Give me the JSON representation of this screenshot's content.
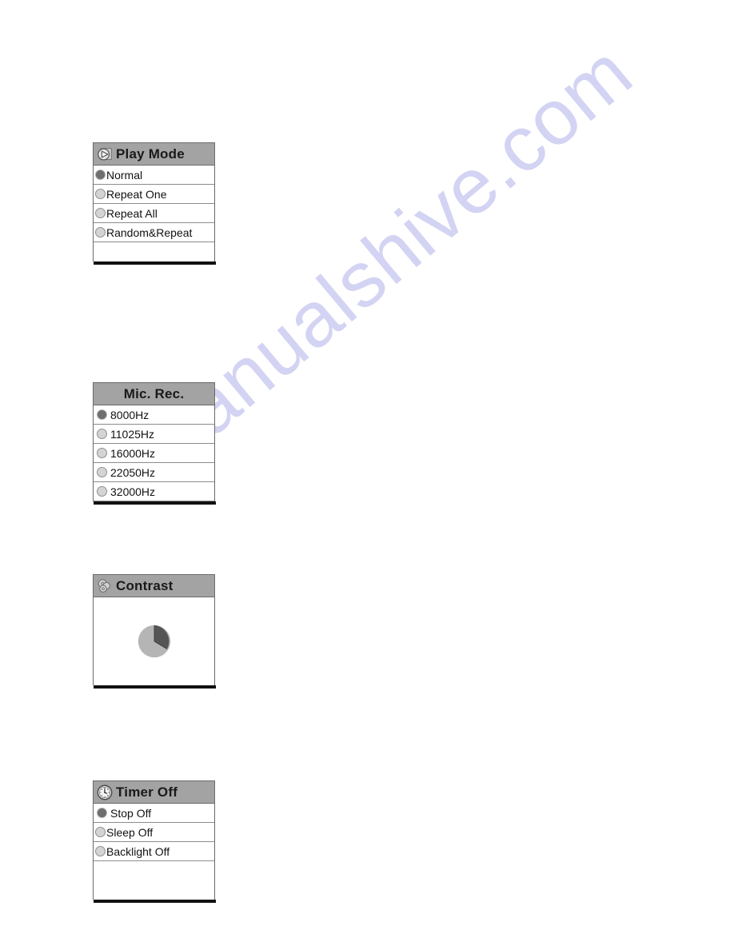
{
  "document": {
    "watermark": "manualshive.com",
    "background_color": "#ffffff"
  },
  "theme": {
    "header_gray": "#a3a3a3",
    "border_gray": "#6b6b6b",
    "row_divider": "#8c8c8c",
    "radio_selected": "#6e6e6e",
    "radio_unselected": "#d4d4d4",
    "baseline_black": "#111111",
    "text": "#111111",
    "watermark_color": "#ccccf2"
  },
  "screens": [
    {
      "id": "play-mode",
      "title": "Play Mode",
      "icon": "play-icon",
      "title_align": "left",
      "options": [
        {
          "label": "Normal",
          "selected": true
        },
        {
          "label": "Repeat One",
          "selected": false
        },
        {
          "label": "Repeat All",
          "selected": false
        },
        {
          "label": "Random&Repeat",
          "selected": false
        }
      ],
      "blank_rows": 1
    },
    {
      "id": "mic-rec",
      "title": "Mic. Rec.",
      "icon": null,
      "title_align": "center",
      "options": [
        {
          "label": "8000Hz",
          "selected": true
        },
        {
          "label": "11025Hz",
          "selected": false
        },
        {
          "label": "16000Hz",
          "selected": false
        },
        {
          "label": "22050Hz",
          "selected": false
        },
        {
          "label": "32000Hz",
          "selected": false
        }
      ],
      "blank_rows": 0
    },
    {
      "id": "contrast",
      "title": "Contrast",
      "icon": "contrast-icon",
      "title_align": "left",
      "options": [],
      "indicator": {
        "type": "pie",
        "filled_percent": 28,
        "filled_color": "#555555",
        "empty_color": "#b5b5b5"
      },
      "blank_rows": 0
    },
    {
      "id": "timer-off",
      "title": "Timer Off",
      "icon": "clock-icon",
      "title_align": "left",
      "options": [
        {
          "label": "Stop Off",
          "selected": true
        },
        {
          "label": "Sleep Off",
          "selected": false
        },
        {
          "label": "Backlight Off",
          "selected": false
        }
      ],
      "blank_rows": 1
    }
  ]
}
